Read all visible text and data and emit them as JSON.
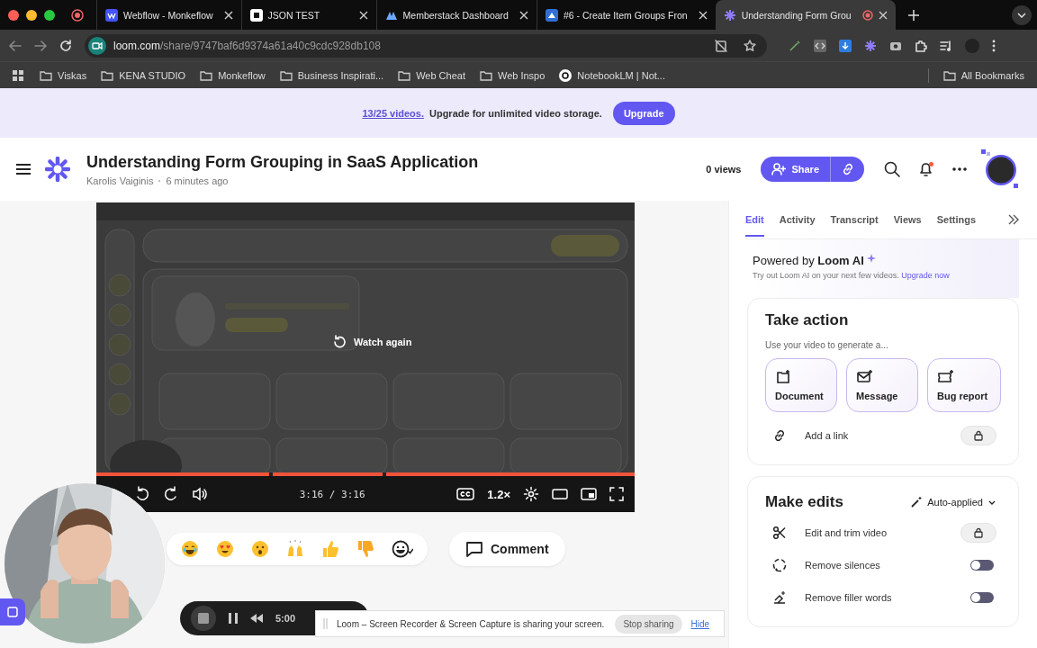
{
  "browser": {
    "tabs": [
      {
        "title": "Webflow - Monkeflow",
        "kind": "webflow",
        "selected": false
      },
      {
        "title": "JSON TEST",
        "kind": "notion",
        "selected": false
      },
      {
        "title": "Memberstack Dashboard",
        "kind": "memberstack",
        "selected": false
      },
      {
        "title": "#6 - Create Item Groups Fron",
        "kind": "azure",
        "selected": false
      },
      {
        "title": "Understanding Form Grou",
        "kind": "loom",
        "selected": true
      }
    ],
    "url_host": "loom.com",
    "url_path": "/share/9747baf6d9374a61a40c9cdc928db108",
    "bookmarks": [
      {
        "label": "Viskas",
        "kind": "folder"
      },
      {
        "label": "KENA STUDIO",
        "kind": "folder"
      },
      {
        "label": "Monkeflow",
        "kind": "folder"
      },
      {
        "label": "Business Inspirati...",
        "kind": "folder"
      },
      {
        "label": "Web Cheat",
        "kind": "folder"
      },
      {
        "label": "Web Inspo",
        "kind": "folder"
      },
      {
        "label": "NotebookLM | Not...",
        "kind": "site"
      }
    ],
    "all_bookmarks": "All Bookmarks"
  },
  "banner": {
    "count": "13/25 videos.",
    "message": "Upgrade for unlimited video storage.",
    "button": "Upgrade"
  },
  "header": {
    "title": "Understanding Form Grouping in SaaS Application",
    "author": "Karolis Vaiginis",
    "time": "6 minutes ago",
    "views": "0 views",
    "share": "Share"
  },
  "player": {
    "overlay": "Watch again",
    "time": "3:16 / 3:16",
    "speed": "1.2×",
    "level": 1
  },
  "comment": "Comment",
  "panel": {
    "tabs": [
      {
        "label": "Edit",
        "selected": true
      },
      {
        "label": "Activity",
        "selected": false
      },
      {
        "label": "Transcript",
        "selected": false
      },
      {
        "label": "Views",
        "selected": false
      },
      {
        "label": "Settings",
        "selected": false
      }
    ],
    "ai_title": "Powered by **Loom AI**",
    "ai_text": "Try out Loom AI on your next few videos.",
    "ai_link": "Upgrade now",
    "take_action": {
      "title": "Take action",
      "subtitle": "Use your video to generate a...",
      "actions": [
        {
          "label": "Document",
          "kind": "document"
        },
        {
          "label": "Message",
          "kind": "message"
        },
        {
          "label": "Bug report",
          "kind": "bug"
        }
      ],
      "link_row": {
        "label": "Add a link",
        "locked": true
      }
    },
    "make_edits": {
      "title": "Make edits",
      "mode": "Auto-applied",
      "items": [
        {
          "label": "Edit and trim video",
          "kind": "trim",
          "locked": true
        },
        {
          "label": "Remove silences",
          "kind": "silence",
          "on": false
        },
        {
          "label": "Remove filler words",
          "kind": "filler",
          "on": false
        }
      ]
    }
  },
  "recorder": {
    "time": "5:00"
  },
  "share_notice": {
    "message": "Loom – Screen Recorder & Screen Capture is sharing your screen.",
    "stop": "Stop sharing",
    "hide": "Hide"
  }
}
